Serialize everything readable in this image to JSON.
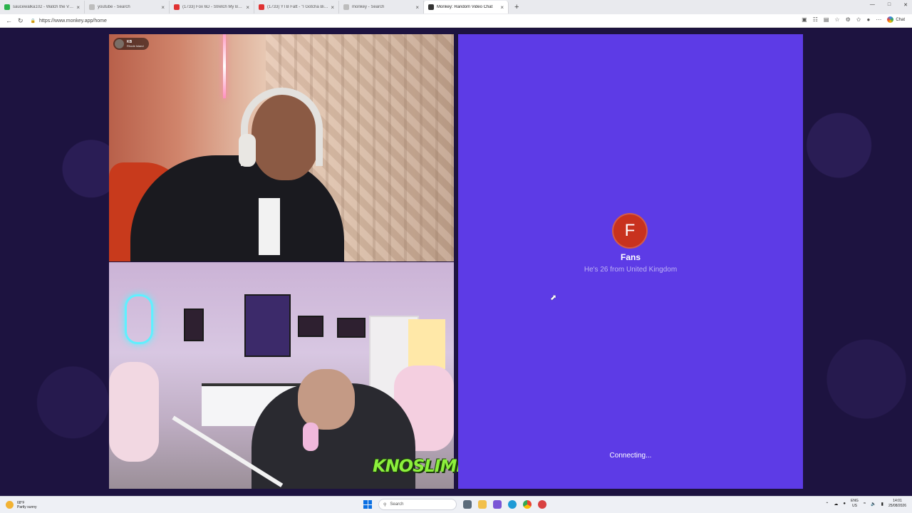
{
  "browser": {
    "tabs": [
      {
        "title": "saucewalka102 - Watch the VOD",
        "favicon_color": "#2bb24c",
        "active": false
      },
      {
        "title": "youtube - Search",
        "favicon_color": "#bdbdbd",
        "active": false
      },
      {
        "title": "(1733) Fox 6D - Stretch My Back",
        "favicon_color": "#e03232",
        "active": false
      },
      {
        "title": "(1733) YTB Fatt - \"I Gotcha Bitch\"",
        "favicon_color": "#e03232",
        "active": false
      },
      {
        "title": "monkey - Search",
        "favicon_color": "#bdbdbd",
        "active": false
      },
      {
        "title": "Monkey: Random Video Chat",
        "favicon_color": "#333333",
        "active": true
      }
    ],
    "new_tab_label": "+",
    "url": "https://www.monkey.app/home",
    "chat_label": "Chat"
  },
  "video_self": {
    "user_name": "KB",
    "user_location": "Rhode Island"
  },
  "overlay_brand": "KNOSLIMETHEMOVIE",
  "match_panel": {
    "avatar_initial": "F",
    "avatar_color": "#c8321e",
    "name": "Fans",
    "subtitle": "He's 26 from United Kingdom",
    "status": "Connecting...",
    "background": "#5d3be6"
  },
  "taskbar": {
    "weather_temp": "68°F",
    "weather_desc": "Partly sunny",
    "search_placeholder": "Search",
    "lang_top": "ENG",
    "lang_bottom": "US",
    "time": "14:01",
    "date": "25/08/2026"
  }
}
